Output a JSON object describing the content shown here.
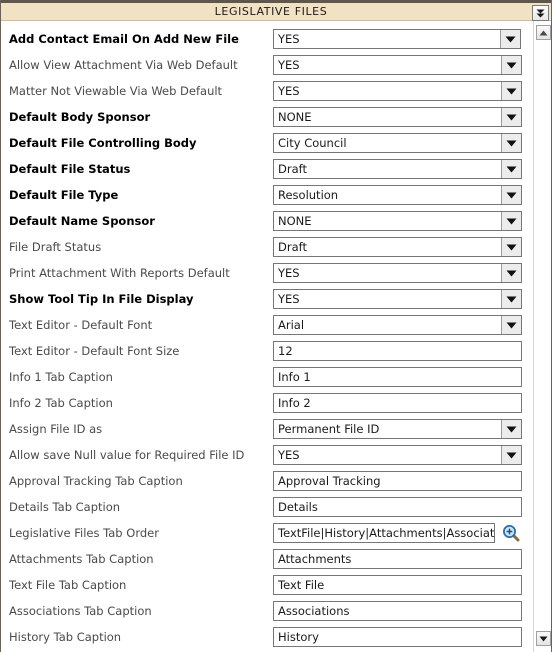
{
  "header": {
    "title": "LEGISLATIVE FILES",
    "collapse_icon": "double-chevron-down-icon"
  },
  "scrollbar": {
    "up_icon": "scroll-up-arrow-icon",
    "down_icon": "scroll-down-arrow-icon"
  },
  "icons": {
    "dropdown_arrow": "chevron-down-icon",
    "lookup": "magnifier-plus-icon"
  },
  "colors": {
    "header_bg": "#f2e2c4",
    "header_border": "#5f574c",
    "field_border": "#767676",
    "label_bold": "#000000",
    "label_normal": "#4a4a4a",
    "lookup_icon": "#2f6fa8"
  },
  "rows": [
    {
      "label": "Add Contact Email On Add New File",
      "bold": true,
      "type": "select",
      "value": "YES",
      "short": true
    },
    {
      "label": "Allow View Attachment Via Web Default",
      "bold": false,
      "type": "select",
      "value": "YES"
    },
    {
      "label": "Matter Not Viewable Via Web Default",
      "bold": false,
      "type": "select",
      "value": "YES"
    },
    {
      "label": "Default Body Sponsor",
      "bold": true,
      "type": "select",
      "value": "NONE"
    },
    {
      "label": "Default File Controlling Body",
      "bold": true,
      "type": "select",
      "value": "City Council"
    },
    {
      "label": "Default File Status",
      "bold": true,
      "type": "select",
      "value": "Draft"
    },
    {
      "label": "Default File Type",
      "bold": true,
      "type": "select",
      "value": "Resolution"
    },
    {
      "label": "Default Name Sponsor",
      "bold": true,
      "type": "select",
      "value": "NONE"
    },
    {
      "label": "File Draft Status",
      "bold": false,
      "type": "select",
      "value": "Draft"
    },
    {
      "label": "Print Attachment With Reports Default",
      "bold": false,
      "type": "select",
      "value": "YES"
    },
    {
      "label": "Show Tool Tip In File Display",
      "bold": true,
      "type": "select",
      "value": "YES"
    },
    {
      "label": "Text Editor - Default Font",
      "bold": false,
      "type": "select",
      "value": "Arial"
    },
    {
      "label": "Text Editor - Default Font Size",
      "bold": false,
      "type": "text",
      "value": "12"
    },
    {
      "label": "Info 1 Tab Caption",
      "bold": false,
      "type": "text",
      "value": "Info 1"
    },
    {
      "label": "Info 2 Tab Caption",
      "bold": false,
      "type": "text",
      "value": "Info 2"
    },
    {
      "label": "Assign File ID as",
      "bold": false,
      "type": "select",
      "value": "Permanent File ID"
    },
    {
      "label": "Allow save Null value for Required File ID",
      "bold": false,
      "type": "select",
      "value": "YES"
    },
    {
      "label": "Approval Tracking Tab Caption",
      "bold": false,
      "type": "text",
      "value": "Approval Tracking"
    },
    {
      "label": "Details Tab Caption",
      "bold": false,
      "type": "text",
      "value": "Details"
    },
    {
      "label": "Legislative Files Tab Order",
      "bold": false,
      "type": "lookup",
      "value": "TextFile|History|Attachments|Associations|D"
    },
    {
      "label": "Attachments Tab Caption",
      "bold": false,
      "type": "text",
      "value": "Attachments"
    },
    {
      "label": "Text File Tab Caption",
      "bold": false,
      "type": "text",
      "value": "Text File"
    },
    {
      "label": "Associations Tab Caption",
      "bold": false,
      "type": "text",
      "value": "Associations"
    },
    {
      "label": "History Tab Caption",
      "bold": false,
      "type": "text",
      "value": "History"
    }
  ]
}
